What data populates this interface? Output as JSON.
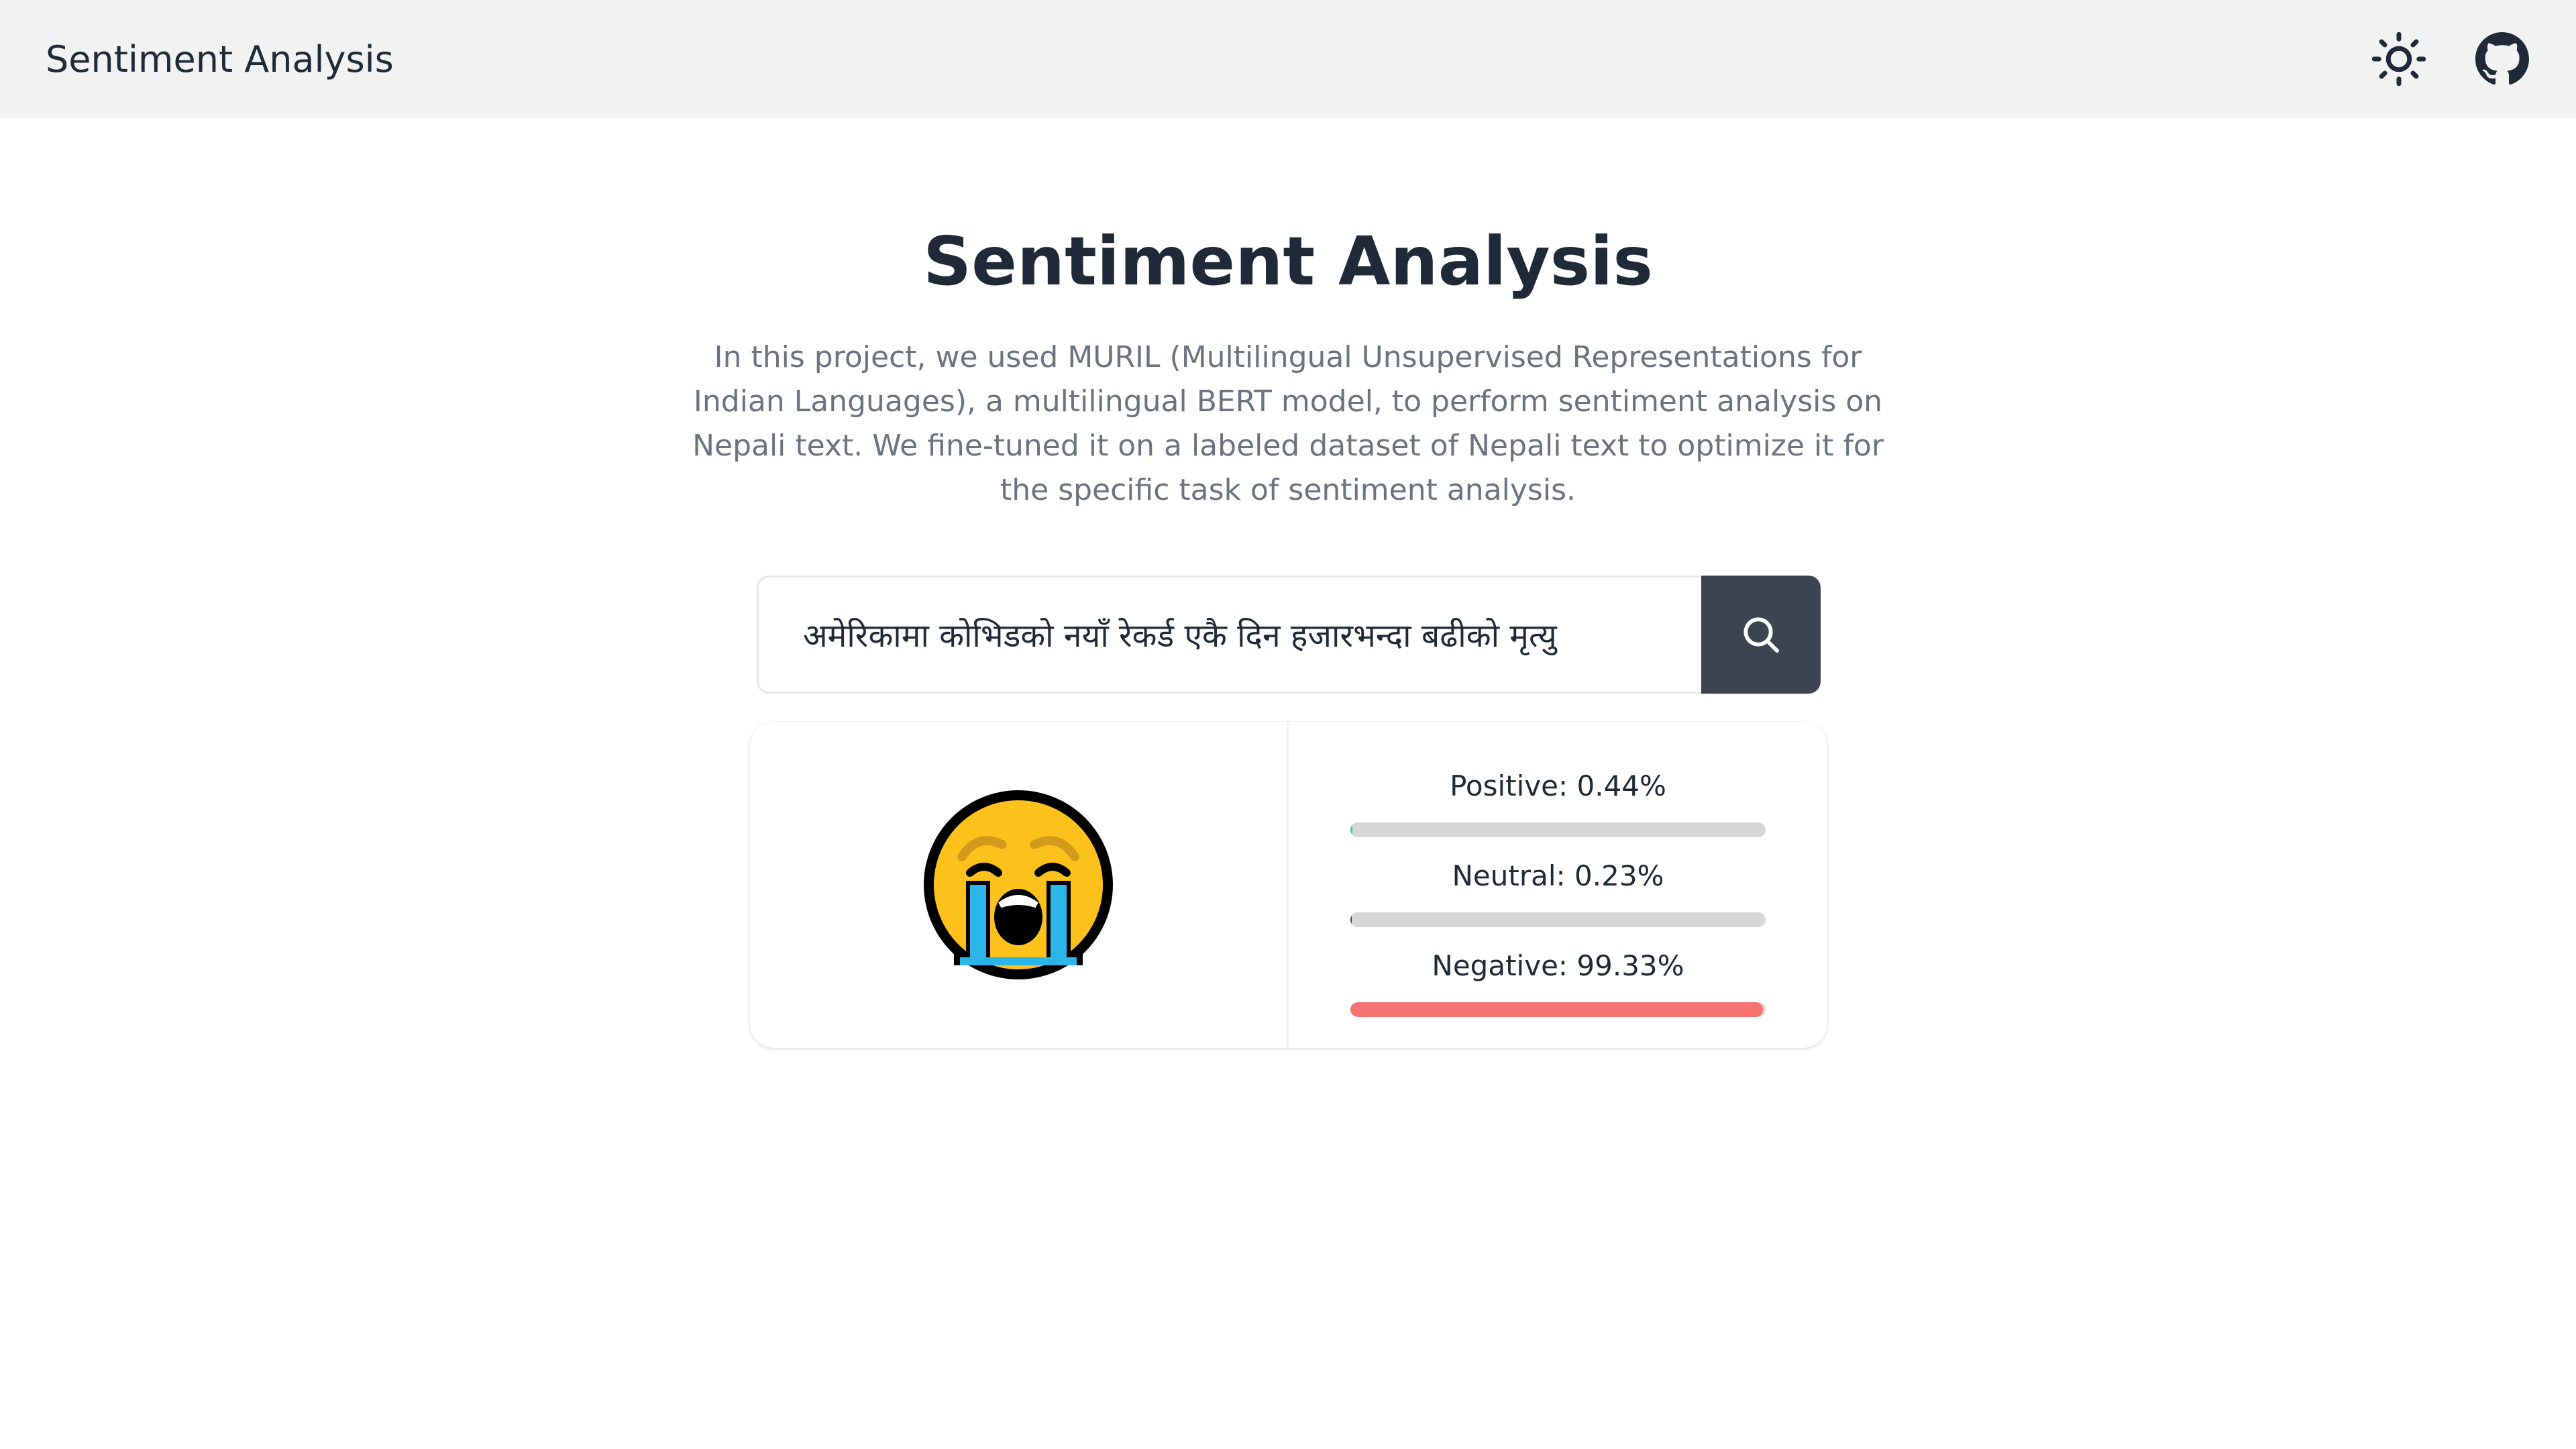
{
  "navbar": {
    "title": "Sentiment Analysis",
    "theme_icon": "sun-icon",
    "github_icon": "github-icon"
  },
  "hero": {
    "title": "Sentiment Analysis",
    "description": "In this project, we used MURIL (Multilingual Unsupervised Representations for Indian Languages), a multilingual BERT model, to perform sentiment analysis on Nepali text. We fine-tuned it on a labeled dataset of Nepali text to optimize it for the specific task of sentiment analysis."
  },
  "search": {
    "value": "अमेरिकामा कोभिडको नयाँ रेकर्ड एकै दिन हजारभन्दा बढीको मृत्यु",
    "button_icon": "search-icon"
  },
  "result": {
    "emoji": "loudly-crying-face-icon",
    "scores": [
      {
        "label": "Positive: 0.44%",
        "value": 0.44,
        "color": "#36d399"
      },
      {
        "label": "Neutral: 0.23%",
        "value": 0.23,
        "color": "#3d4451"
      },
      {
        "label": "Negative: 99.33%",
        "value": 99.33,
        "color": "#f87272"
      }
    ]
  },
  "colors": {
    "navbar_bg": "#f2f2f2",
    "button_bg": "#3d4451",
    "negative": "#f87272",
    "track": "#d6d6d6"
  }
}
